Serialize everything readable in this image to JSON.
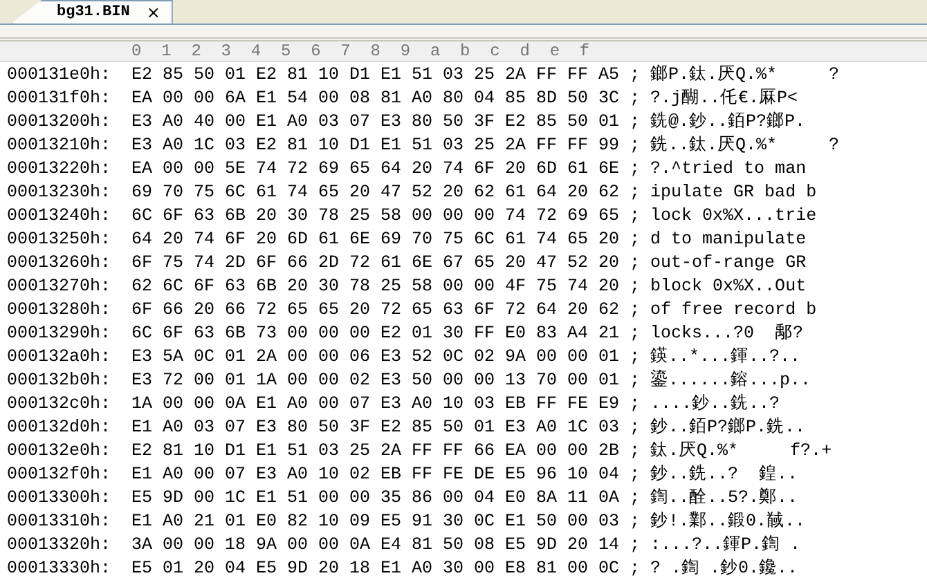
{
  "tabs": [
    {
      "label": "bg31.BIN",
      "close": "×",
      "selected": true
    }
  ],
  "columns": [
    "0",
    "1",
    "2",
    "3",
    "4",
    "5",
    "6",
    "7",
    "8",
    "9",
    "a",
    "b",
    "c",
    "d",
    "e",
    "f"
  ],
  "rows": [
    {
      "offset": "000131e0h:",
      "hex": "E2 85 50 01 E2 81 10 D1 E1 51 03 25 2A FF FF A5",
      "separator": ";",
      "text": "鎯P.鈦.厌Q.%*     ?"
    },
    {
      "offset": "000131f0h:",
      "hex": "EA 00 00 6A E1 54 00 08 81 A0 80 04 85 8D 50 3C",
      "separator": ";",
      "text": "?.j醐..仛€.厤P<"
    },
    {
      "offset": "00013200h:",
      "hex": "E3 A0 40 00 E1 A0 03 07 E3 80 50 3F E2 85 50 01",
      "separator": ";",
      "text": "銑@.鈔..銆P?鎯P."
    },
    {
      "offset": "00013210h:",
      "hex": "E3 A0 1C 03 E2 81 10 D1 E1 51 03 25 2A FF FF 99",
      "separator": ";",
      "text": "銑..鈦.厌Q.%*     ?"
    },
    {
      "offset": "00013220h:",
      "hex": "EA 00 00 5E 74 72 69 65 64 20 74 6F 20 6D 61 6E",
      "separator": ";",
      "text": "?.^tried to man"
    },
    {
      "offset": "00013230h:",
      "hex": "69 70 75 6C 61 74 65 20 47 52 20 62 61 64 20 62",
      "separator": ";",
      "text": "ipulate GR bad b"
    },
    {
      "offset": "00013240h:",
      "hex": "6C 6F 63 6B 20 30 78 25 58 00 00 00 74 72 69 65",
      "separator": ";",
      "text": "lock 0x%X...trie"
    },
    {
      "offset": "00013250h:",
      "hex": "64 20 74 6F 20 6D 61 6E 69 70 75 6C 61 74 65 20",
      "separator": ";",
      "text": "d to manipulate"
    },
    {
      "offset": "00013260h:",
      "hex": "6F 75 74 2D 6F 66 2D 72 61 6E 67 65 20 47 52 20",
      "separator": ";",
      "text": "out-of-range GR"
    },
    {
      "offset": "00013270h:",
      "hex": "62 6C 6F 63 6B 20 30 78 25 58 00 00 4F 75 74 20",
      "separator": ";",
      "text": "block 0x%X..Out"
    },
    {
      "offset": "00013280h:",
      "hex": "6F 66 20 66 72 65 65 20 72 65 63 6F 72 64 20 62",
      "separator": ";",
      "text": "of free record b"
    },
    {
      "offset": "00013290h:",
      "hex": "6C 6F 63 6B 73 00 00 00 E2 01 30 FF E0 83 A4 21",
      "separator": ";",
      "text": "locks...?0  鄅?"
    },
    {
      "offset": "000132a0h:",
      "hex": "E3 5A 0C 01 2A 00 00 06 E3 52 0C 02 9A 00 00 01",
      "separator": ";",
      "text": "鍈..*...鍕..?.."
    },
    {
      "offset": "000132b0h:",
      "hex": "E3 72 00 01 1A 00 00 02 E3 50 00 00 13 70 00 01",
      "separator": ";",
      "text": "鎏......鎔...p.."
    },
    {
      "offset": "000132c0h:",
      "hex": "1A 00 00 0A E1 A0 00 07 E3 A0 10 03 EB FF FE E9",
      "separator": ";",
      "text": "....鈔..銑..?"
    },
    {
      "offset": "000132d0h:",
      "hex": "E1 A0 03 07 E3 80 50 3F E2 85 50 01 E3 A0 1C 03",
      "separator": ";",
      "text": "鈔..銆P?鎯P.銑.."
    },
    {
      "offset": "000132e0h:",
      "hex": "E2 81 10 D1 E1 51 03 25 2A FF FF 66 EA 00 00 2B",
      "separator": ";",
      "text": "鈦.厌Q.%*     f?.+"
    },
    {
      "offset": "000132f0h:",
      "hex": "E1 A0 00 07 E3 A0 10 02 EB FF FE DE E5 96 10 04",
      "separator": ";",
      "text": "鈔..銑..?  鍠.."
    },
    {
      "offset": "00013300h:",
      "hex": "E5 9D 00 1C E1 51 00 00 35 86 00 04 E0 8A 11 0A",
      "separator": ";",
      "text": "鍧..酫..5?.鄭.."
    },
    {
      "offset": "00013310h:",
      "hex": "E1 A0 21 01 E0 82 10 09 E5 91 30 0C E1 50 00 03",
      "separator": ";",
      "text": "鈔!.鄴..鍛0.馘.."
    },
    {
      "offset": "00013320h:",
      "hex": "3A 00 00 18 9A 00 00 0A E4 81 50 08 E5 9D 20 14",
      "separator": ";",
      "text": ":...?..鍕P.鍧 ."
    },
    {
      "offset": "00013330h:",
      "hex": "E5 01 20 04 E5 9D 20 18 E1 A0 30 00 E8 81 00 0C",
      "separator": ";",
      "text": "? .鍧 .鈔0.鑱.."
    }
  ]
}
